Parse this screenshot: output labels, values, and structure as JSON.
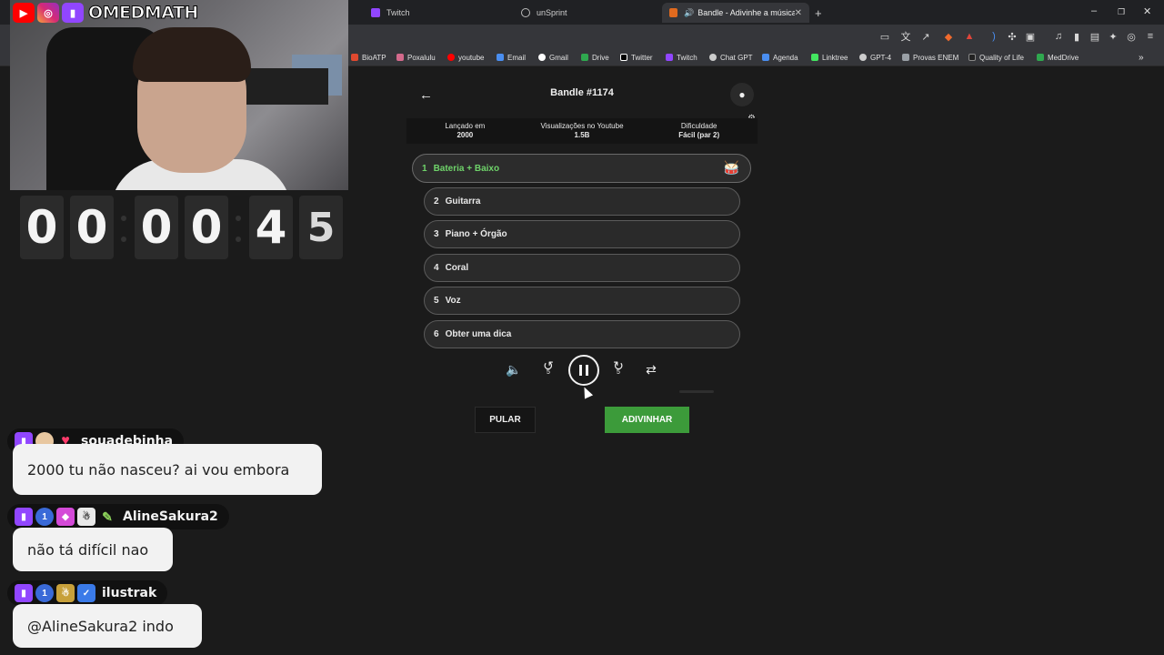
{
  "browser": {
    "tabs": [
      {
        "label": "Twitch",
        "icon": "twitch-icon"
      },
      {
        "label": "unSprint",
        "icon": "globe-icon"
      },
      {
        "label": "Bandle - Adivinhe a música, u",
        "icon": "bandle-icon",
        "active": true
      }
    ],
    "new_tab_label": "+",
    "bookmarks": [
      {
        "label": "BioATP",
        "color": "#e0492f"
      },
      {
        "label": "Poxalulu",
        "color": "#d46a8c"
      },
      {
        "label": "youtube",
        "color": "#ff0000"
      },
      {
        "label": "Email",
        "color": "#4a8ef0"
      },
      {
        "label": "Gmail",
        "color": "#ffffff"
      },
      {
        "label": "Drive",
        "color": "#2fa84f"
      },
      {
        "label": "Twitter",
        "color": "#ffffff"
      },
      {
        "label": "Twitch",
        "color": "#9146ff"
      },
      {
        "label": "Chat GPT",
        "color": "#cccccc"
      },
      {
        "label": "Agenda",
        "color": "#4a8ef0"
      },
      {
        "label": "Linktree",
        "color": "#43e660"
      },
      {
        "label": "GPT-4",
        "color": "#cccccc"
      },
      {
        "label": "Provas ENEM",
        "color": "#9aa0a6"
      },
      {
        "label": "Quality of Life",
        "color": "#222222"
      },
      {
        "label": "MedDrive",
        "color": "#2fa84f"
      }
    ],
    "more_bookmarks": "»"
  },
  "overlay": {
    "handle": "OMEDMATH",
    "timer_digits": [
      "0",
      "0",
      "0",
      "0",
      "4",
      "5"
    ]
  },
  "chat": [
    {
      "user": "souadebinha",
      "message": "2000 tu não nasceu? ai vou embora"
    },
    {
      "user": "AlineSakura2",
      "message": "não tá difícil nao"
    },
    {
      "user": "ilustrak",
      "message": "@AlineSakura2 indo"
    }
  ],
  "game": {
    "title": "Bandle #1174",
    "info": [
      {
        "label": "Lançado em",
        "value": "2000"
      },
      {
        "label": "Visualizações no Youtube",
        "value": "1.5B"
      },
      {
        "label": "Dificuldade",
        "value": "Fácil (par 2)"
      }
    ],
    "tracks": [
      {
        "num": "1",
        "label": "Bateria + Baixo"
      },
      {
        "num": "2",
        "label": "Guitarra"
      },
      {
        "num": "3",
        "label": "Piano + Órgão"
      },
      {
        "num": "4",
        "label": "Coral"
      },
      {
        "num": "5",
        "label": "Voz"
      },
      {
        "num": "6",
        "label": "Obter uma dica"
      }
    ],
    "rewind_label": "5",
    "forward_label": "5",
    "skip_label": "PULAR",
    "guess_label": "ADIVINHAR",
    "accent_color": "#3c9b3a",
    "active_track_color": "#6fd36a"
  }
}
